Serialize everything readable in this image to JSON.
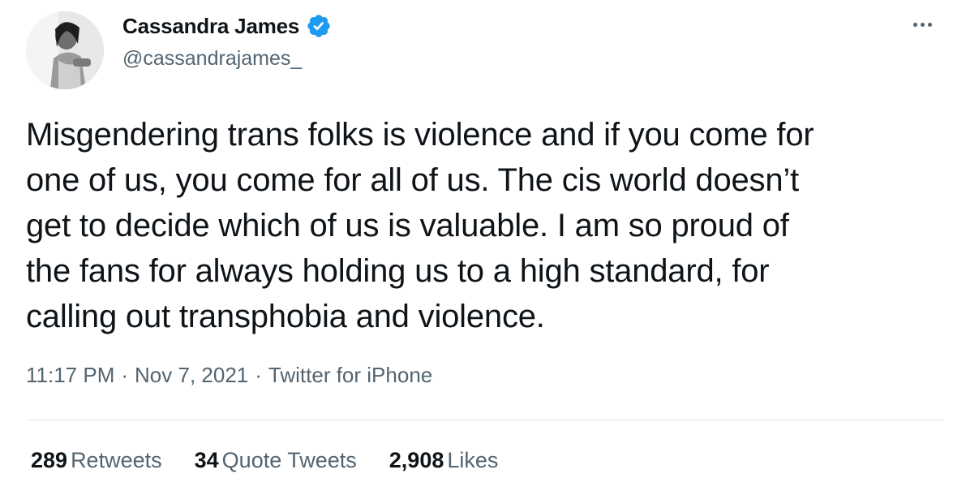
{
  "author": {
    "name": "Cassandra James",
    "handle": "@cassandrajames_",
    "avatar_icon": "profile-photo",
    "verified_icon": "verified-badge-icon",
    "verified_color": "#1d9bf0"
  },
  "more_icon": "more-options-icon",
  "tweet": {
    "lines": [
      "Misgendering trans folks is violence and if you come for",
      "one of us, you come for all of us. The cis world doesn’t",
      "get to decide which of us is valuable. I am so proud of",
      "the fans for always holding us to a high standard, for",
      "calling out transphobia and violence."
    ]
  },
  "meta": {
    "time": "11:17 PM",
    "date": "Nov 7, 2021",
    "source": "Twitter for iPhone",
    "separator": "·"
  },
  "stats": {
    "retweets_count": "289",
    "retweets_label": "Retweets",
    "quotes_count": "34",
    "quotes_label": "Quote Tweets",
    "likes_count": "2,908",
    "likes_label": "Likes"
  },
  "colors": {
    "text_primary": "#0f1419",
    "text_secondary": "#536471",
    "divider": "#e5e7ea"
  }
}
